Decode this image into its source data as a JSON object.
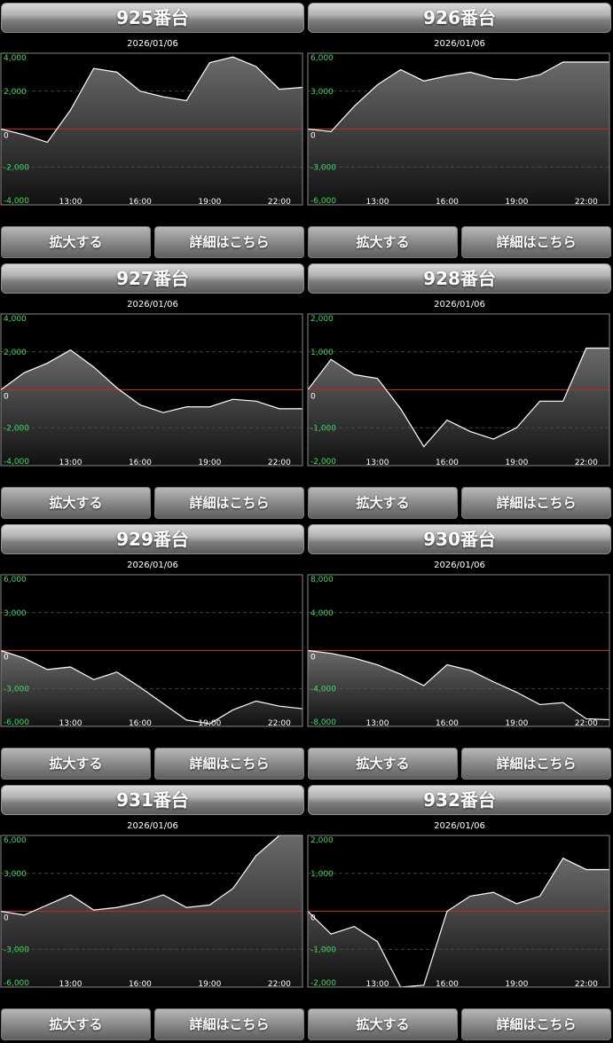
{
  "ui": {
    "zoom_label": "拡大する",
    "detail_label": "詳細はこちら"
  },
  "colors": {
    "axis_label": "#3ddc62",
    "zero_line": "#d02020",
    "series_line": "#ffffff",
    "area_fill": "#6a6a6a"
  },
  "machines": [
    {
      "title": "925番台",
      "date": "2026/01/06",
      "chart_data": {
        "type": "area",
        "x": [
          "10:00",
          "11:00",
          "12:00",
          "13:00",
          "14:00",
          "15:00",
          "16:00",
          "17:00",
          "18:00",
          "19:00",
          "20:00",
          "21:00",
          "22:00",
          "23:00"
        ],
        "y": [
          0,
          -300,
          -700,
          1000,
          3200,
          3000,
          2000,
          1700,
          1500,
          3500,
          3800,
          3300,
          2100,
          2200
        ],
        "ylim": [
          -4000,
          4000
        ],
        "yticks": [
          "4,000",
          "2,000",
          "0",
          "-2,000",
          "-4,000"
        ],
        "xticks": [
          "13:00",
          "16:00",
          "19:00",
          "22:00"
        ]
      }
    },
    {
      "title": "926番台",
      "date": "2026/01/06",
      "chart_data": {
        "type": "area",
        "x": [
          "10:00",
          "11:00",
          "12:00",
          "13:00",
          "14:00",
          "15:00",
          "16:00",
          "17:00",
          "18:00",
          "19:00",
          "20:00",
          "21:00",
          "22:00",
          "23:00"
        ],
        "y": [
          0,
          -200,
          1800,
          3500,
          4700,
          3800,
          4200,
          4500,
          4000,
          3900,
          4300,
          5300,
          5300,
          5300
        ],
        "ylim": [
          -6000,
          6000
        ],
        "yticks": [
          "6,000",
          "3,000",
          "0",
          "-3,000",
          "-6,000"
        ],
        "xticks": [
          "13:00",
          "16:00",
          "19:00",
          "22:00"
        ]
      }
    },
    {
      "title": "927番台",
      "date": "2026/01/06",
      "chart_data": {
        "type": "area",
        "x": [
          "10:00",
          "11:00",
          "12:00",
          "13:00",
          "14:00",
          "15:00",
          "16:00",
          "17:00",
          "18:00",
          "19:00",
          "20:00",
          "21:00",
          "22:00",
          "23:00"
        ],
        "y": [
          0,
          900,
          1400,
          2100,
          1200,
          100,
          -800,
          -1200,
          -900,
          -900,
          -500,
          -600,
          -1000,
          -1000
        ],
        "ylim": [
          -4000,
          4000
        ],
        "yticks": [
          "4,000",
          "2,000",
          "0",
          "-2,000",
          "-4,000"
        ],
        "xticks": [
          "13:00",
          "16:00",
          "19:00",
          "22:00"
        ]
      }
    },
    {
      "title": "928番台",
      "date": "2026/01/06",
      "chart_data": {
        "type": "area",
        "x": [
          "10:00",
          "11:00",
          "12:00",
          "13:00",
          "14:00",
          "15:00",
          "16:00",
          "17:00",
          "18:00",
          "19:00",
          "20:00",
          "21:00",
          "22:00",
          "23:00"
        ],
        "y": [
          0,
          800,
          400,
          300,
          -500,
          -1500,
          -800,
          -1100,
          -1300,
          -1000,
          -300,
          -300,
          1100,
          1100
        ],
        "ylim": [
          -2000,
          2000
        ],
        "yticks": [
          "2,000",
          "1,000",
          "0",
          "-1,000",
          "-2,000"
        ],
        "xticks": [
          "13:00",
          "16:00",
          "19:00",
          "22:00"
        ]
      }
    },
    {
      "title": "929番台",
      "date": "2026/01/06",
      "chart_data": {
        "type": "area",
        "x": [
          "10:00",
          "11:00",
          "12:00",
          "13:00",
          "14:00",
          "15:00",
          "16:00",
          "17:00",
          "18:00",
          "19:00",
          "20:00",
          "21:00",
          "22:00",
          "23:00"
        ],
        "y": [
          0,
          -600,
          -1500,
          -1300,
          -2300,
          -1700,
          -2900,
          -4200,
          -5500,
          -5800,
          -4700,
          -4000,
          -4400,
          -4600
        ],
        "ylim": [
          -6000,
          6000
        ],
        "yticks": [
          "6,000",
          "3,000",
          "0",
          "-3,000",
          "-6,000"
        ],
        "xticks": [
          "13:00",
          "16:00",
          "19:00",
          "22:00"
        ]
      }
    },
    {
      "title": "930番台",
      "date": "2026/01/06",
      "chart_data": {
        "type": "area",
        "x": [
          "10:00",
          "11:00",
          "12:00",
          "13:00",
          "14:00",
          "15:00",
          "16:00",
          "17:00",
          "18:00",
          "19:00",
          "20:00",
          "21:00",
          "22:00",
          "23:00"
        ],
        "y": [
          0,
          -300,
          -800,
          -1500,
          -2500,
          -3700,
          -1500,
          -2100,
          -3300,
          -4400,
          -5700,
          -5500,
          -7200,
          -7300
        ],
        "ylim": [
          -8000,
          8000
        ],
        "yticks": [
          "8,000",
          "4,000",
          "0",
          "-4,000",
          "-8,000"
        ],
        "xticks": [
          "13:00",
          "16:00",
          "19:00",
          "22:00"
        ]
      }
    },
    {
      "title": "931番台",
      "date": "2026/01/06",
      "chart_data": {
        "type": "area",
        "x": [
          "10:00",
          "11:00",
          "12:00",
          "13:00",
          "14:00",
          "15:00",
          "16:00",
          "17:00",
          "18:00",
          "19:00",
          "20:00",
          "21:00",
          "22:00",
          "23:00"
        ],
        "y": [
          0,
          -300,
          500,
          1300,
          100,
          300,
          700,
          1300,
          300,
          500,
          1800,
          4400,
          6000,
          6000
        ],
        "ylim": [
          -6000,
          6000
        ],
        "yticks": [
          "6,000",
          "3,000",
          "0",
          "-3,000",
          "-6,000"
        ],
        "xticks": [
          "13:00",
          "16:00",
          "19:00",
          "22:00"
        ]
      }
    },
    {
      "title": "932番台",
      "date": "2026/01/06",
      "chart_data": {
        "type": "area",
        "x": [
          "10:00",
          "11:00",
          "12:00",
          "13:00",
          "14:00",
          "15:00",
          "16:00",
          "17:00",
          "18:00",
          "19:00",
          "20:00",
          "21:00",
          "22:00",
          "23:00"
        ],
        "y": [
          0,
          -600,
          -400,
          -800,
          -2000,
          -1950,
          0,
          400,
          500,
          200,
          400,
          1400,
          1100,
          1100
        ],
        "ylim": [
          -2000,
          2000
        ],
        "yticks": [
          "2,000",
          "1,000",
          "0",
          "-1,000",
          "-2,000"
        ],
        "xticks": [
          "13:00",
          "16:00",
          "19:00",
          "22:00"
        ]
      }
    }
  ]
}
